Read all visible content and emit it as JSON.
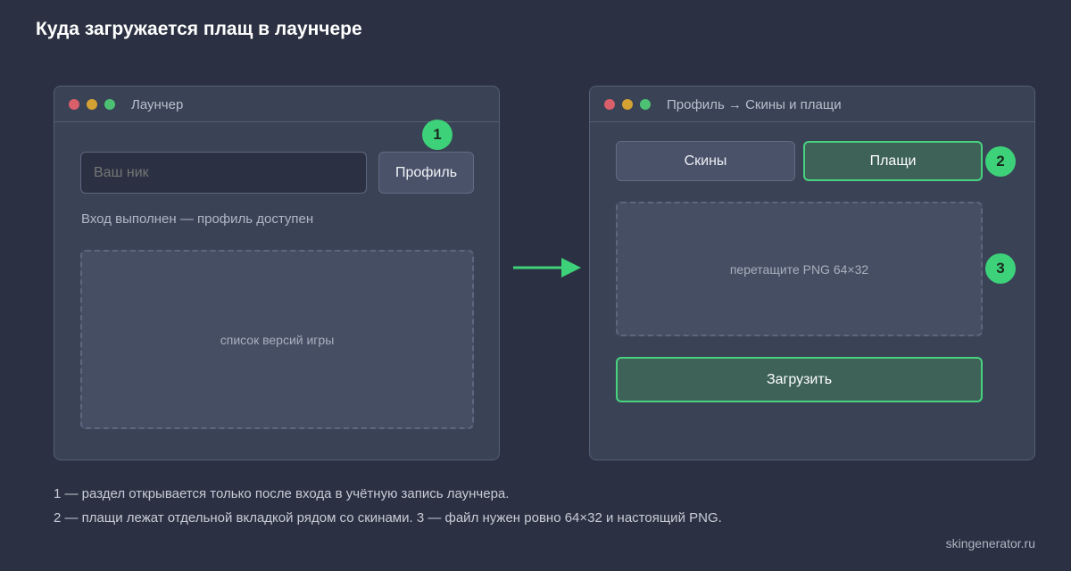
{
  "page": {
    "title": "Куда загружается плащ в лаунчере",
    "site": "skingenerator.ru"
  },
  "colors": {
    "background": "#2b3142",
    "window": "#3a4255",
    "accent_green": "#3dd27a",
    "button_green_fill": "#3e6258",
    "dot_red": "#d95f6b",
    "dot_yellow": "#d3a233",
    "dot_green": "#4cc173"
  },
  "launcher_window": {
    "title": "Лаунчер",
    "nick_placeholder": "Ваш ник",
    "profile_button": "Профиль",
    "status": "Вход выполнен — профиль доступен",
    "versions_placeholder": "список версий игры",
    "badge": "1"
  },
  "profile_window": {
    "title": "Профиль → Скины и плащи",
    "tabs": [
      {
        "label": "Скины",
        "active": false
      },
      {
        "label": "Плащи",
        "active": true
      }
    ],
    "drop_zone": "перетащите PNG 64×32",
    "upload_button": "Загрузить",
    "badge_tabs": "2",
    "badge_drop": "3"
  },
  "icons": {
    "arrow": "arrow-right-icon"
  },
  "footnotes": [
    "1 — раздел открывается только после входа в учётную запись лаунчера.",
    "2 — плащи лежат отдельной вкладкой рядом со скинами. 3 — файл нужен ровно 64×32 и настоящий PNG."
  ]
}
